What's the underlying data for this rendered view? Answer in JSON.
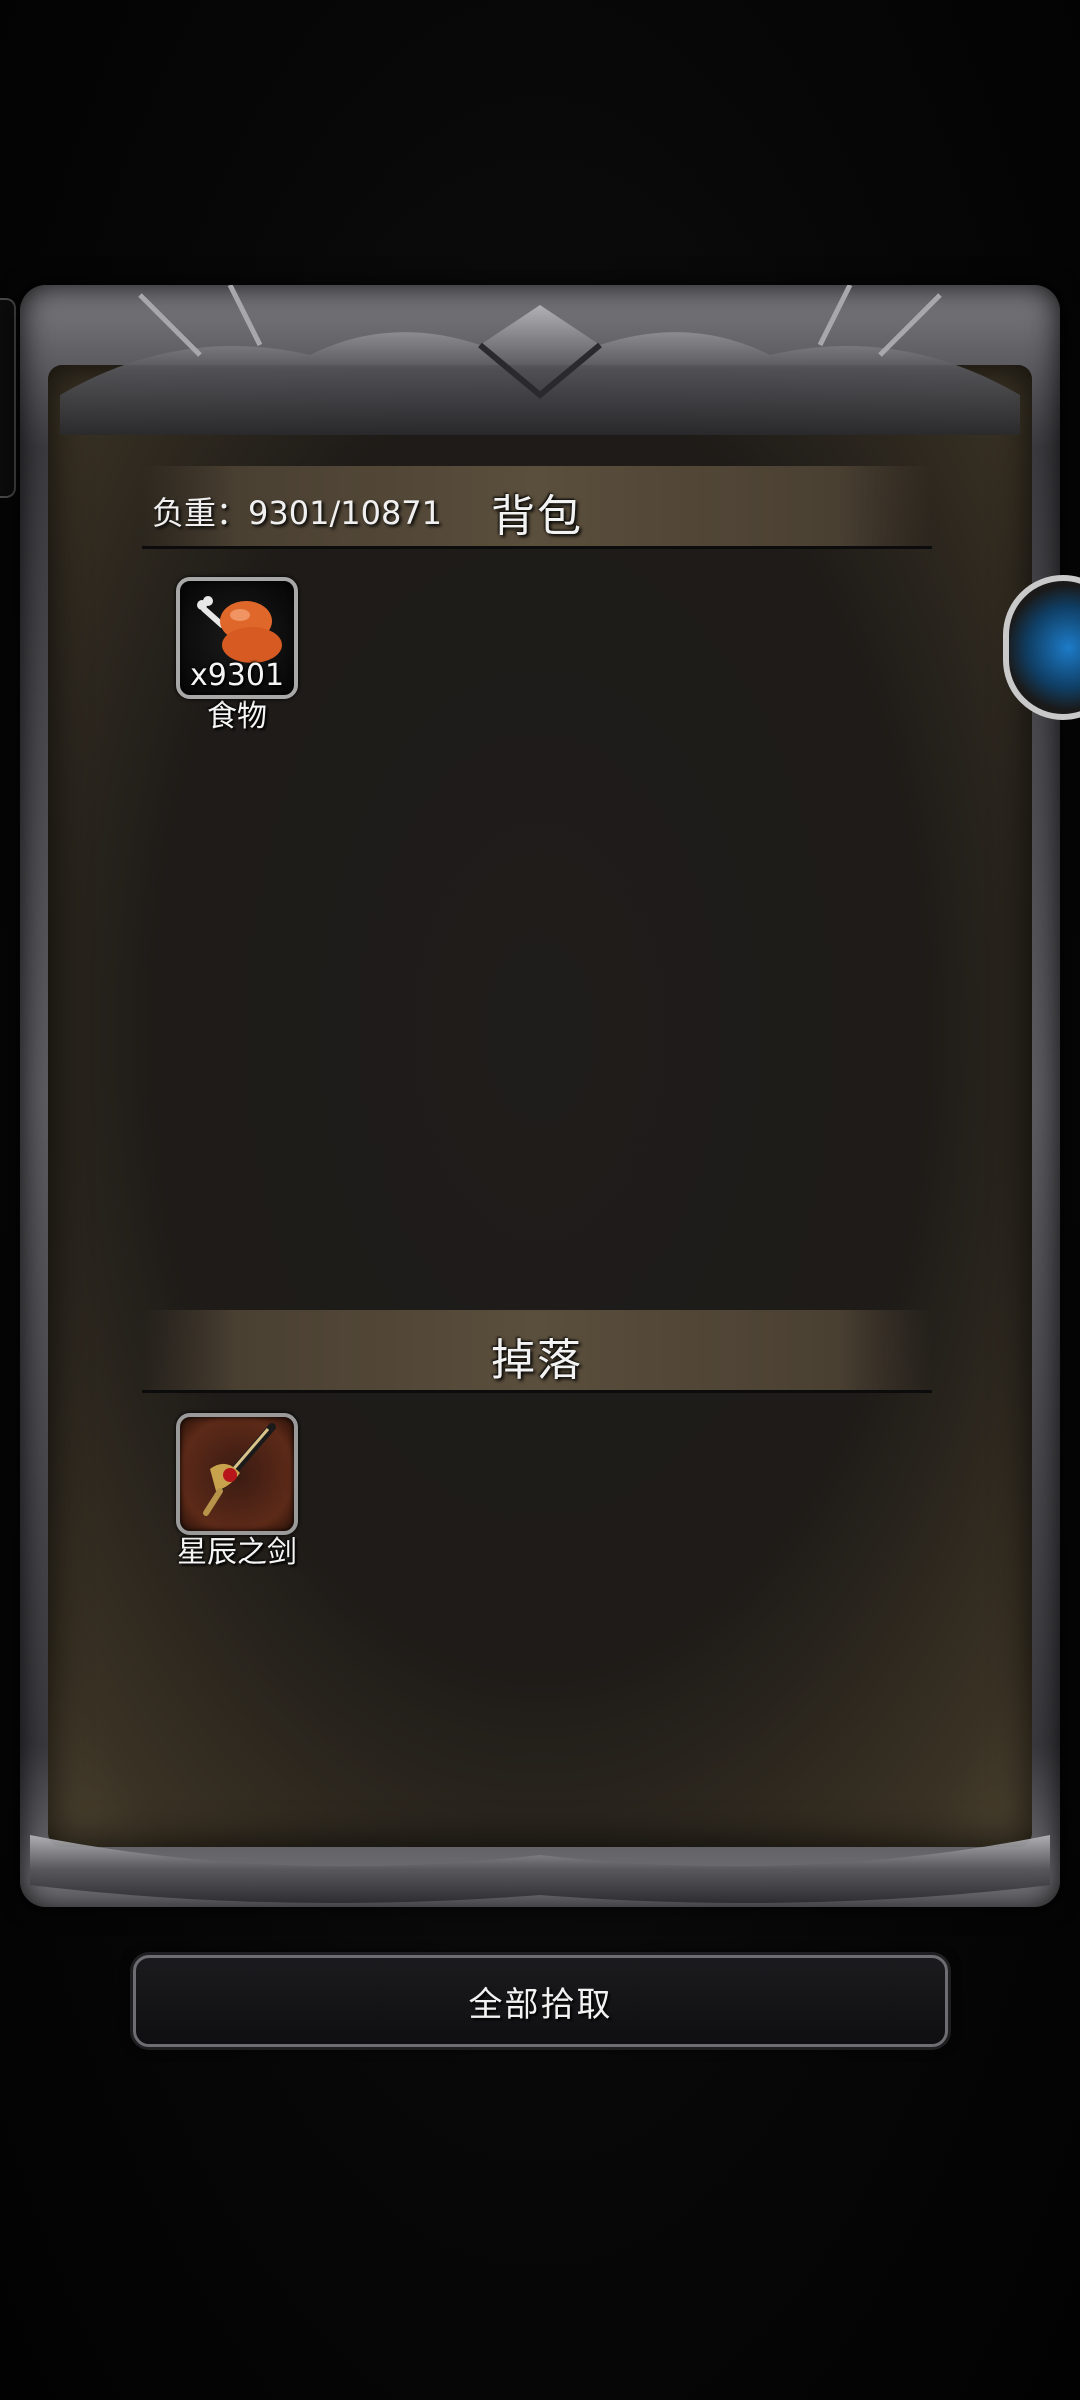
{
  "bag": {
    "title": "背包",
    "weight_label": "负重：9301/10871",
    "items": [
      {
        "name": "食物",
        "count": "x9301",
        "icon": "chicken-leg-icon"
      }
    ]
  },
  "drop": {
    "title": "掉落",
    "items": [
      {
        "name": "星辰之剑",
        "count": "",
        "icon": "sword-icon"
      }
    ]
  },
  "actions": {
    "pickup_all_label": "全部拾取"
  },
  "colors": {
    "panel_bg": "#1f1d1b",
    "header_bg": "#5a4e3c",
    "text": "#f2f2f2"
  }
}
